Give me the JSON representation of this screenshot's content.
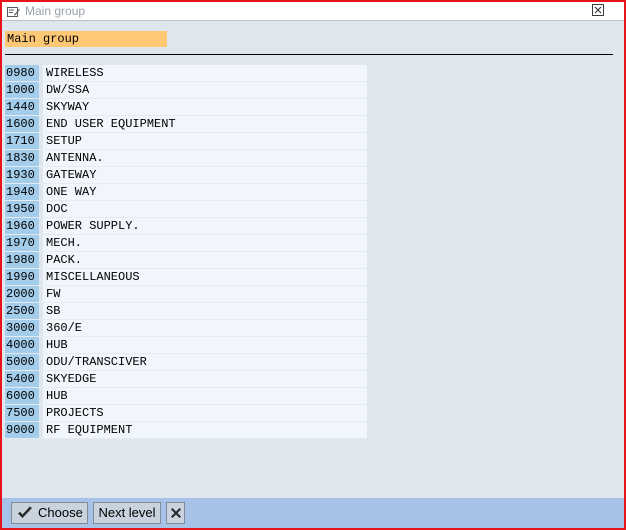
{
  "window": {
    "title": "Main group"
  },
  "list": {
    "column_header": "Main group",
    "rows": [
      {
        "code": "0980",
        "desc": "WIRELESS"
      },
      {
        "code": "1000",
        "desc": "DW/SSA"
      },
      {
        "code": "1440",
        "desc": "SKYWAY"
      },
      {
        "code": "1600",
        "desc": "END USER EQUIPMENT"
      },
      {
        "code": "1710",
        "desc": "SETUP"
      },
      {
        "code": "1830",
        "desc": "ANTENNA."
      },
      {
        "code": "1930",
        "desc": "GATEWAY"
      },
      {
        "code": "1940",
        "desc": "ONE WAY"
      },
      {
        "code": "1950",
        "desc": "DOC"
      },
      {
        "code": "1960",
        "desc": "POWER SUPPLY."
      },
      {
        "code": "1970",
        "desc": "MECH."
      },
      {
        "code": "1980",
        "desc": "PACK."
      },
      {
        "code": "1990",
        "desc": "MISCELLANEOUS"
      },
      {
        "code": "2000",
        "desc": "FW"
      },
      {
        "code": "2500",
        "desc": "SB"
      },
      {
        "code": "3000",
        "desc": "360/E"
      },
      {
        "code": "4000",
        "desc": "HUB"
      },
      {
        "code": "5000",
        "desc": "ODU/TRANSCIVER"
      },
      {
        "code": "5400",
        "desc": "SKYEDGE"
      },
      {
        "code": "6000",
        "desc": "HUB"
      },
      {
        "code": "7500",
        "desc": "PROJECTS"
      },
      {
        "code": "9000",
        "desc": "RF EQUIPMENT"
      }
    ]
  },
  "footer": {
    "choose_label": "Choose",
    "next_level_label": "Next level",
    "cancel_icon": "cancel-icon"
  },
  "colors": {
    "window_border": "#e8141c",
    "column_header_bg": "#ffc875",
    "code_cell_bg": "#a3cdeb",
    "footer_bg": "#a6c2e8"
  }
}
